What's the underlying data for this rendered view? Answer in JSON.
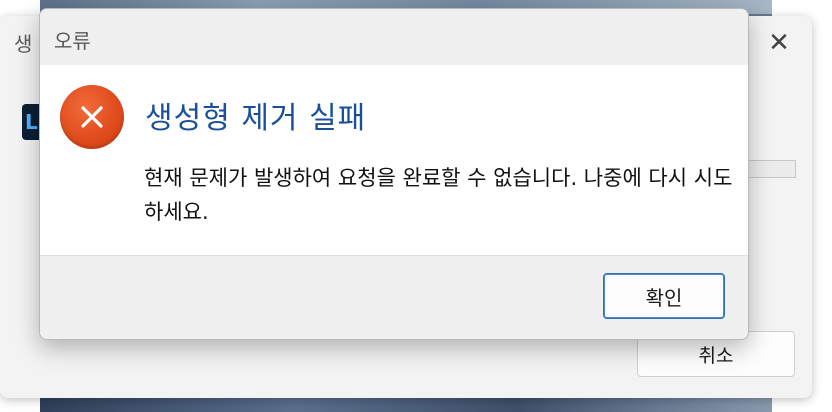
{
  "parent_window": {
    "title": "생",
    "close_glyph": "✕",
    "app_icon_letter": "L",
    "cancel_label": "취소"
  },
  "dialog": {
    "title": "오류",
    "icon": "error-x-icon",
    "heading": "생성형 제거 실패",
    "message": "현재 문제가 발생하여 요청을 완료할 수 없습니다. 나중에 다시 시도하세요.",
    "ok_label": "확인"
  },
  "colors": {
    "heading": "#1a4f99",
    "error_icon": "#de4a1c",
    "ok_border": "#2f6fb0"
  }
}
